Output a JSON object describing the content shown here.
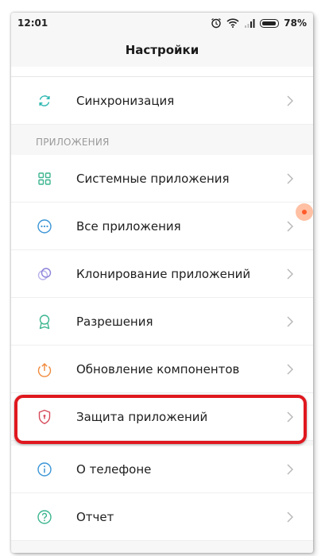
{
  "status": {
    "time": "12:01",
    "battery": "78%"
  },
  "header": {
    "title": "Настройки"
  },
  "items_top": [
    {
      "label": "Синхронизация",
      "icon": "sync-icon",
      "color": "#2bb7b0"
    }
  ],
  "section": {
    "title": "ПРИЛОЖЕНИЯ"
  },
  "items_apps": [
    {
      "label": "Системные приложения",
      "icon": "grid-icon",
      "color": "#3cb58f"
    },
    {
      "label": "Все приложения",
      "icon": "dots-icon",
      "color": "#3a95d6"
    },
    {
      "label": "Клонирование приложений",
      "icon": "clone-icon",
      "color": "#8a82d8"
    },
    {
      "label": "Разрешения",
      "icon": "ribbon-icon",
      "color": "#3cb58f"
    },
    {
      "label": "Обновление компонентов",
      "icon": "upload-icon",
      "color": "#f08a3c"
    },
    {
      "label": "Защита приложений",
      "icon": "shield-icon",
      "color": "#d64a5a"
    }
  ],
  "items_bottom": [
    {
      "label": "О телефоне",
      "icon": "info-icon",
      "color": "#3a95d6"
    },
    {
      "label": "Отчет",
      "icon": "question-icon",
      "color": "#3cb58f"
    }
  ],
  "colors": {
    "highlight": "#e0181f",
    "chevron": "#b5b5b5"
  }
}
